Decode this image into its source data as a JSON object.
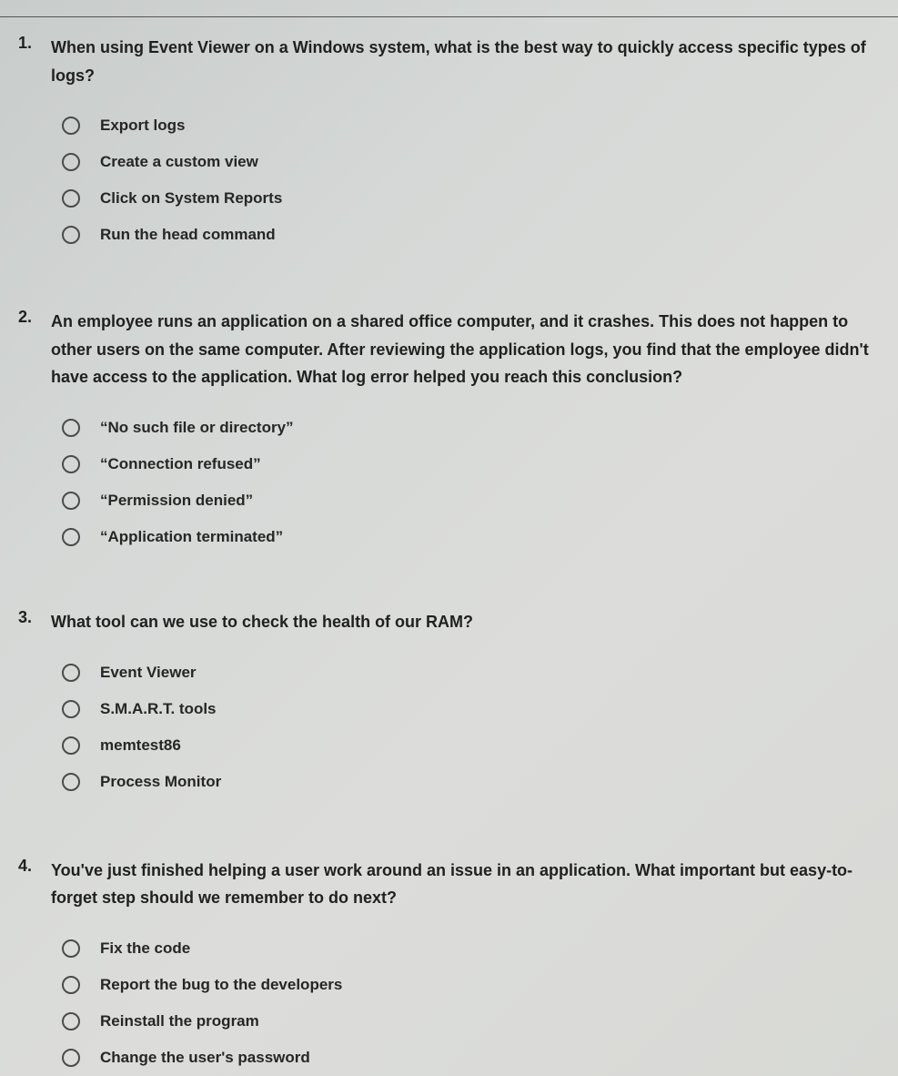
{
  "questions": [
    {
      "number": "1.",
      "text": "When using Event Viewer on a Windows system, what is the best way to quickly access specific types of logs?",
      "options": [
        "Export logs",
        "Create a custom view",
        "Click on System Reports",
        "Run the head command"
      ]
    },
    {
      "number": "2.",
      "text": "An employee runs an application on a shared office computer, and it crashes. This does not happen to other users on the same computer. After reviewing the application logs, you find that the employee didn't have access to the application. What log error helped you reach this conclusion?",
      "options": [
        "“No such file or directory”",
        "“Connection refused”",
        "“Permission denied”",
        "“Application terminated”"
      ]
    },
    {
      "number": "3.",
      "text": "What tool can we use to check the health of our RAM?",
      "options": [
        "Event Viewer",
        "S.M.A.R.T. tools",
        "memtest86",
        "Process Monitor"
      ]
    },
    {
      "number": "4.",
      "text": "You've just finished helping a user work around an issue in an application. What important but easy-to-forget step should we remember to do next?",
      "options": [
        "Fix the code",
        "Report the bug to the developers",
        "Reinstall the program",
        "Change the user's password"
      ]
    }
  ]
}
